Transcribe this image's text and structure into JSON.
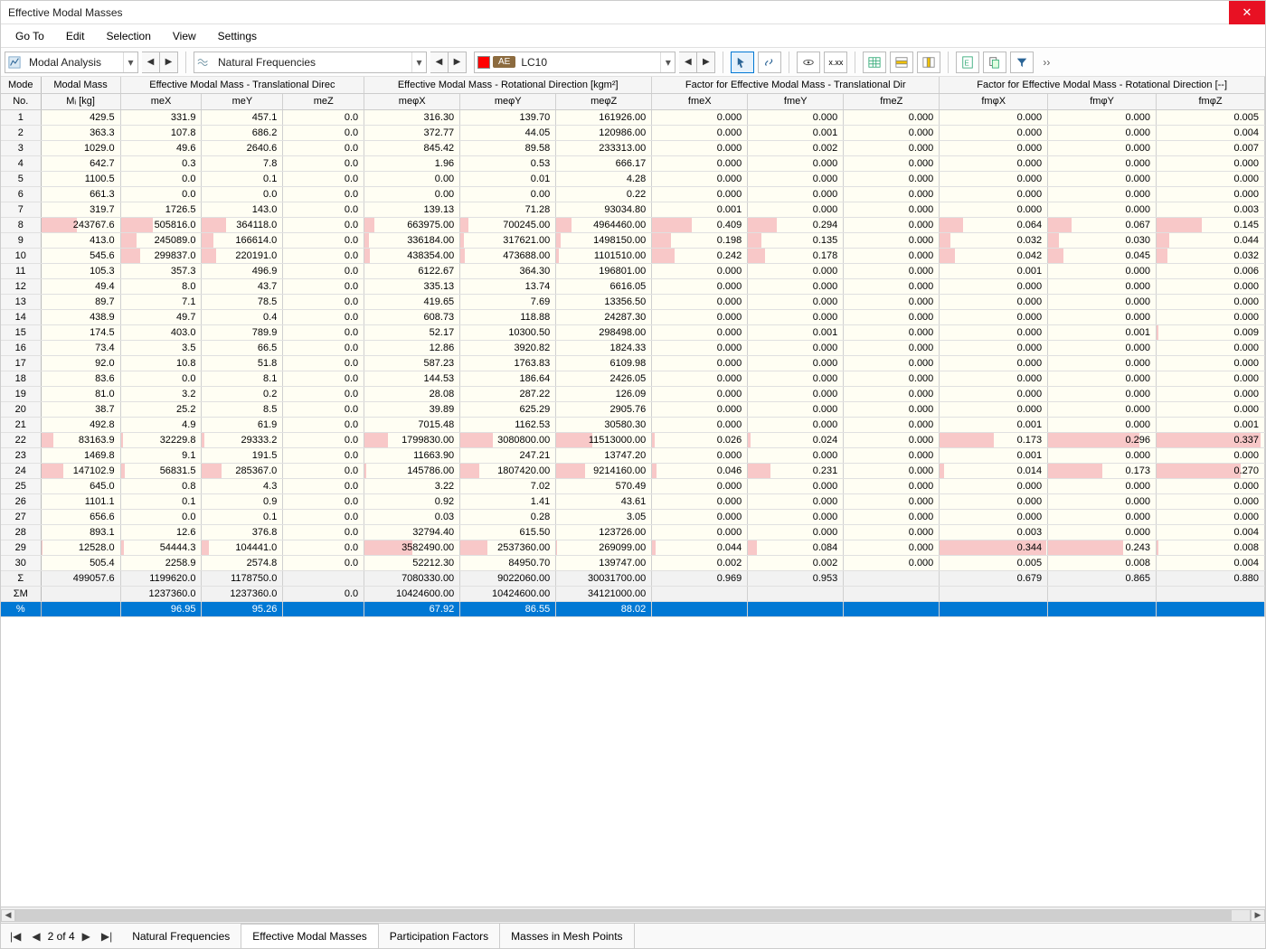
{
  "window": {
    "title": "Effective Modal Masses"
  },
  "menu": [
    "Go To",
    "Edit",
    "Selection",
    "View",
    "Settings"
  ],
  "toolbar": {
    "combo1": "Modal Analysis",
    "combo2": "Natural Frequencies",
    "combo3": "LC10",
    "ae": "AE"
  },
  "headers": {
    "group0": "Mode No.",
    "group1": "Modal Mass",
    "group2": "Effective Modal Mass - Translational Direc",
    "group3": "Effective Modal Mass - Rotational Direction [kgm²]",
    "group4": "Factor for Effective Modal Mass - Translational Dir",
    "group5": "Factor for Effective Modal Mass - Rotational Direction [--]",
    "sub": [
      "Mᵢ [kg]",
      "meX",
      "meY",
      "meZ",
      "meφX",
      "meφY",
      "meφZ",
      "fmeX",
      "fmeY",
      "fmeZ",
      "fmφX",
      "fmφY",
      "fmφZ"
    ]
  },
  "rows": [
    {
      "n": "1",
      "v": [
        "429.5",
        "331.9",
        "457.1",
        "0.0",
        "316.30",
        "139.70",
        "161926.00",
        "0.000",
        "0.000",
        "0.000",
        "0.000",
        "0.000",
        "0.005"
      ],
      "hl": [
        0,
        0,
        0,
        0,
        0,
        0,
        0,
        0,
        0,
        0,
        0,
        0,
        0
      ]
    },
    {
      "n": "2",
      "v": [
        "363.3",
        "107.8",
        "686.2",
        "0.0",
        "372.77",
        "44.05",
        "120986.00",
        "0.000",
        "0.001",
        "0.000",
        "0.000",
        "0.000",
        "0.004"
      ],
      "hl": [
        0,
        0,
        0,
        0,
        0,
        0,
        0,
        0,
        0,
        0,
        0,
        0,
        0
      ]
    },
    {
      "n": "3",
      "v": [
        "1029.0",
        "49.6",
        "2640.6",
        "0.0",
        "845.42",
        "89.58",
        "233313.00",
        "0.000",
        "0.002",
        "0.000",
        "0.000",
        "0.000",
        "0.007"
      ],
      "hl": [
        0,
        0,
        0,
        0,
        0,
        0,
        0,
        0,
        0,
        0,
        0,
        0,
        0
      ]
    },
    {
      "n": "4",
      "v": [
        "642.7",
        "0.3",
        "7.8",
        "0.0",
        "1.96",
        "0.53",
        "666.17",
        "0.000",
        "0.000",
        "0.000",
        "0.000",
        "0.000",
        "0.000"
      ],
      "hl": [
        0,
        0,
        0,
        0,
        0,
        0,
        0,
        0,
        0,
        0,
        0,
        0,
        0
      ]
    },
    {
      "n": "5",
      "v": [
        "1100.5",
        "0.0",
        "0.1",
        "0.0",
        "0.00",
        "0.01",
        "4.28",
        "0.000",
        "0.000",
        "0.000",
        "0.000",
        "0.000",
        "0.000"
      ],
      "hl": [
        0,
        0,
        0,
        0,
        0,
        0,
        0,
        0,
        0,
        0,
        0,
        0,
        0
      ]
    },
    {
      "n": "6",
      "v": [
        "661.3",
        "0.0",
        "0.0",
        "0.0",
        "0.00",
        "0.00",
        "0.22",
        "0.000",
        "0.000",
        "0.000",
        "0.000",
        "0.000",
        "0.000"
      ],
      "hl": [
        0,
        0,
        0,
        0,
        0,
        0,
        0,
        0,
        0,
        0,
        0,
        0,
        0
      ]
    },
    {
      "n": "7",
      "v": [
        "319.7",
        "1726.5",
        "143.0",
        "0.0",
        "139.13",
        "71.28",
        "93034.80",
        "0.001",
        "0.000",
        "0.000",
        "0.000",
        "0.000",
        "0.003"
      ],
      "hl": [
        0,
        0,
        0,
        0,
        0,
        0,
        0,
        0,
        0,
        0,
        0,
        0,
        0
      ]
    },
    {
      "n": "8",
      "v": [
        "243767.6",
        "505816.0",
        "364118.0",
        "0.0",
        "663975.00",
        "700245.00",
        "4964460.00",
        "0.409",
        "0.294",
        "0.000",
        "0.064",
        "0.067",
        "0.145"
      ],
      "hl": [
        0.45,
        0.4,
        0.3,
        0,
        0.1,
        0.08,
        0.16,
        0.42,
        0.3,
        0,
        0.22,
        0.22,
        0.42
      ]
    },
    {
      "n": "9",
      "v": [
        "413.0",
        "245089.0",
        "166614.0",
        "0.0",
        "336184.00",
        "317621.00",
        "1498150.00",
        "0.198",
        "0.135",
        "0.000",
        "0.032",
        "0.030",
        "0.044"
      ],
      "hl": [
        0,
        0.2,
        0.14,
        0,
        0.05,
        0.04,
        0.05,
        0.2,
        0.14,
        0,
        0.1,
        0.1,
        0.12
      ]
    },
    {
      "n": "10",
      "v": [
        "545.6",
        "299837.0",
        "220191.0",
        "0.0",
        "438354.00",
        "473688.00",
        "1101510.00",
        "0.242",
        "0.178",
        "0.000",
        "0.042",
        "0.045",
        "0.032"
      ],
      "hl": [
        0,
        0.24,
        0.18,
        0,
        0.06,
        0.05,
        0.03,
        0.24,
        0.18,
        0,
        0.14,
        0.14,
        0.1
      ]
    },
    {
      "n": "11",
      "v": [
        "105.3",
        "357.3",
        "496.9",
        "0.0",
        "6122.67",
        "364.30",
        "196801.00",
        "0.000",
        "0.000",
        "0.000",
        "0.001",
        "0.000",
        "0.006"
      ],
      "hl": [
        0,
        0,
        0,
        0,
        0,
        0,
        0,
        0,
        0,
        0,
        0,
        0,
        0
      ]
    },
    {
      "n": "12",
      "v": [
        "49.4",
        "8.0",
        "43.7",
        "0.0",
        "335.13",
        "13.74",
        "6616.05",
        "0.000",
        "0.000",
        "0.000",
        "0.000",
        "0.000",
        "0.000"
      ],
      "hl": [
        0,
        0,
        0,
        0,
        0,
        0,
        0,
        0,
        0,
        0,
        0,
        0,
        0
      ]
    },
    {
      "n": "13",
      "v": [
        "89.7",
        "7.1",
        "78.5",
        "0.0",
        "419.65",
        "7.69",
        "13356.50",
        "0.000",
        "0.000",
        "0.000",
        "0.000",
        "0.000",
        "0.000"
      ],
      "hl": [
        0,
        0,
        0,
        0,
        0,
        0,
        0,
        0,
        0,
        0,
        0,
        0,
        0
      ]
    },
    {
      "n": "14",
      "v": [
        "438.9",
        "49.7",
        "0.4",
        "0.0",
        "608.73",
        "118.88",
        "24287.30",
        "0.000",
        "0.000",
        "0.000",
        "0.000",
        "0.000",
        "0.000"
      ],
      "hl": [
        0,
        0,
        0,
        0,
        0,
        0,
        0,
        0,
        0,
        0,
        0,
        0,
        0
      ]
    },
    {
      "n": "15",
      "v": [
        "174.5",
        "403.0",
        "789.9",
        "0.0",
        "52.17",
        "10300.50",
        "298498.00",
        "0.000",
        "0.001",
        "0.000",
        "0.000",
        "0.001",
        "0.009"
      ],
      "hl": [
        0,
        0,
        0,
        0,
        0,
        0,
        0,
        0,
        0,
        0,
        0,
        0,
        0.02
      ]
    },
    {
      "n": "16",
      "v": [
        "73.4",
        "3.5",
        "66.5",
        "0.0",
        "12.86",
        "3920.82",
        "1824.33",
        "0.000",
        "0.000",
        "0.000",
        "0.000",
        "0.000",
        "0.000"
      ],
      "hl": [
        0,
        0,
        0,
        0,
        0,
        0,
        0,
        0,
        0,
        0,
        0,
        0,
        0
      ]
    },
    {
      "n": "17",
      "v": [
        "92.0",
        "10.8",
        "51.8",
        "0.0",
        "587.23",
        "1763.83",
        "6109.98",
        "0.000",
        "0.000",
        "0.000",
        "0.000",
        "0.000",
        "0.000"
      ],
      "hl": [
        0,
        0,
        0,
        0,
        0,
        0,
        0,
        0,
        0,
        0,
        0,
        0,
        0
      ]
    },
    {
      "n": "18",
      "v": [
        "83.6",
        "0.0",
        "8.1",
        "0.0",
        "144.53",
        "186.64",
        "2426.05",
        "0.000",
        "0.000",
        "0.000",
        "0.000",
        "0.000",
        "0.000"
      ],
      "hl": [
        0,
        0,
        0,
        0,
        0,
        0,
        0,
        0,
        0,
        0,
        0,
        0,
        0
      ]
    },
    {
      "n": "19",
      "v": [
        "81.0",
        "3.2",
        "0.2",
        "0.0",
        "28.08",
        "287.22",
        "126.09",
        "0.000",
        "0.000",
        "0.000",
        "0.000",
        "0.000",
        "0.000"
      ],
      "hl": [
        0,
        0,
        0,
        0,
        0,
        0,
        0,
        0,
        0,
        0,
        0,
        0,
        0
      ]
    },
    {
      "n": "20",
      "v": [
        "38.7",
        "25.2",
        "8.5",
        "0.0",
        "39.89",
        "625.29",
        "2905.76",
        "0.000",
        "0.000",
        "0.000",
        "0.000",
        "0.000",
        "0.000"
      ],
      "hl": [
        0,
        0,
        0,
        0,
        0,
        0,
        0,
        0,
        0,
        0,
        0,
        0,
        0
      ]
    },
    {
      "n": "21",
      "v": [
        "492.8",
        "4.9",
        "61.9",
        "0.0",
        "7015.48",
        "1162.53",
        "30580.30",
        "0.000",
        "0.000",
        "0.000",
        "0.001",
        "0.000",
        "0.001"
      ],
      "hl": [
        0,
        0,
        0,
        0,
        0,
        0,
        0,
        0,
        0,
        0,
        0,
        0,
        0
      ]
    },
    {
      "n": "22",
      "v": [
        "83163.9",
        "32229.8",
        "29333.2",
        "0.0",
        "1799830.00",
        "3080800.00",
        "11513000.00",
        "0.026",
        "0.024",
        "0.000",
        "0.173",
        "0.296",
        "0.337"
      ],
      "hl": [
        0.16,
        0.03,
        0.03,
        0,
        0.25,
        0.34,
        0.38,
        0.03,
        0.03,
        0,
        0.5,
        0.85,
        0.97
      ]
    },
    {
      "n": "23",
      "v": [
        "1469.8",
        "9.1",
        "191.5",
        "0.0",
        "11663.90",
        "247.21",
        "13747.20",
        "0.000",
        "0.000",
        "0.000",
        "0.001",
        "0.000",
        "0.000"
      ],
      "hl": [
        0,
        0,
        0,
        0,
        0,
        0,
        0,
        0,
        0,
        0,
        0,
        0,
        0
      ]
    },
    {
      "n": "24",
      "v": [
        "147102.9",
        "56831.5",
        "285367.0",
        "0.0",
        "145786.00",
        "1807420.00",
        "9214160.00",
        "0.046",
        "0.231",
        "0.000",
        "0.014",
        "0.173",
        "0.270"
      ],
      "hl": [
        0.28,
        0.05,
        0.24,
        0,
        0.02,
        0.2,
        0.3,
        0.05,
        0.24,
        0,
        0.04,
        0.5,
        0.78
      ]
    },
    {
      "n": "25",
      "v": [
        "645.0",
        "0.8",
        "4.3",
        "0.0",
        "3.22",
        "7.02",
        "570.49",
        "0.000",
        "0.000",
        "0.000",
        "0.000",
        "0.000",
        "0.000"
      ],
      "hl": [
        0,
        0,
        0,
        0,
        0,
        0,
        0,
        0,
        0,
        0,
        0,
        0,
        0
      ]
    },
    {
      "n": "26",
      "v": [
        "1101.1",
        "0.1",
        "0.9",
        "0.0",
        "0.92",
        "1.41",
        "43.61",
        "0.000",
        "0.000",
        "0.000",
        "0.000",
        "0.000",
        "0.000"
      ],
      "hl": [
        0,
        0,
        0,
        0,
        0,
        0,
        0,
        0,
        0,
        0,
        0,
        0,
        0
      ]
    },
    {
      "n": "27",
      "v": [
        "656.6",
        "0.0",
        "0.1",
        "0.0",
        "0.03",
        "0.28",
        "3.05",
        "0.000",
        "0.000",
        "0.000",
        "0.000",
        "0.000",
        "0.000"
      ],
      "hl": [
        0,
        0,
        0,
        0,
        0,
        0,
        0,
        0,
        0,
        0,
        0,
        0,
        0
      ]
    },
    {
      "n": "28",
      "v": [
        "893.1",
        "12.6",
        "376.8",
        "0.0",
        "32794.40",
        "615.50",
        "123726.00",
        "0.000",
        "0.000",
        "0.000",
        "0.003",
        "0.000",
        "0.004"
      ],
      "hl": [
        0,
        0,
        0,
        0,
        0,
        0,
        0,
        0,
        0,
        0,
        0,
        0,
        0
      ]
    },
    {
      "n": "29",
      "v": [
        "12528.0",
        "54444.3",
        "104441.0",
        "0.0",
        "3582490.00",
        "2537360.00",
        "269099.00",
        "0.044",
        "0.084",
        "0.000",
        "0.344",
        "0.243",
        "0.008"
      ],
      "hl": [
        0.02,
        0.04,
        0.09,
        0,
        0.5,
        0.28,
        0.01,
        0.04,
        0.09,
        0,
        0.99,
        0.7,
        0.02
      ]
    },
    {
      "n": "30",
      "v": [
        "505.4",
        "2258.9",
        "2574.8",
        "0.0",
        "52212.30",
        "84950.70",
        "139747.00",
        "0.002",
        "0.002",
        "0.000",
        "0.005",
        "0.008",
        "0.004"
      ],
      "hl": [
        0,
        0,
        0,
        0,
        0,
        0,
        0,
        0,
        0,
        0,
        0,
        0,
        0
      ]
    }
  ],
  "summary": {
    "sigma": [
      "499057.6",
      "1199620.0",
      "1178750.0",
      "",
      "7080330.00",
      "9022060.00",
      "30031700.00",
      "0.969",
      "0.953",
      "",
      "0.679",
      "0.865",
      "0.880"
    ],
    "sigma_m": [
      "",
      "1237360.0",
      "1237360.0",
      "0.0",
      "10424600.00",
      "10424600.00",
      "34121000.00",
      "",
      "",
      "",
      "",
      "",
      ""
    ],
    "percent": [
      "",
      "96.95",
      "95.26",
      "",
      "67.92",
      "86.55",
      "88.02",
      "",
      "",
      "",
      "",
      "",
      ""
    ]
  },
  "summary_labels": {
    "sigma": "Σ",
    "sigma_m": "ΣM",
    "percent": "%"
  },
  "pager": {
    "text": "2 of 4"
  },
  "tabs": [
    "Natural Frequencies",
    "Effective Modal Masses",
    "Participation Factors",
    "Masses in Mesh Points"
  ],
  "active_tab": 1
}
